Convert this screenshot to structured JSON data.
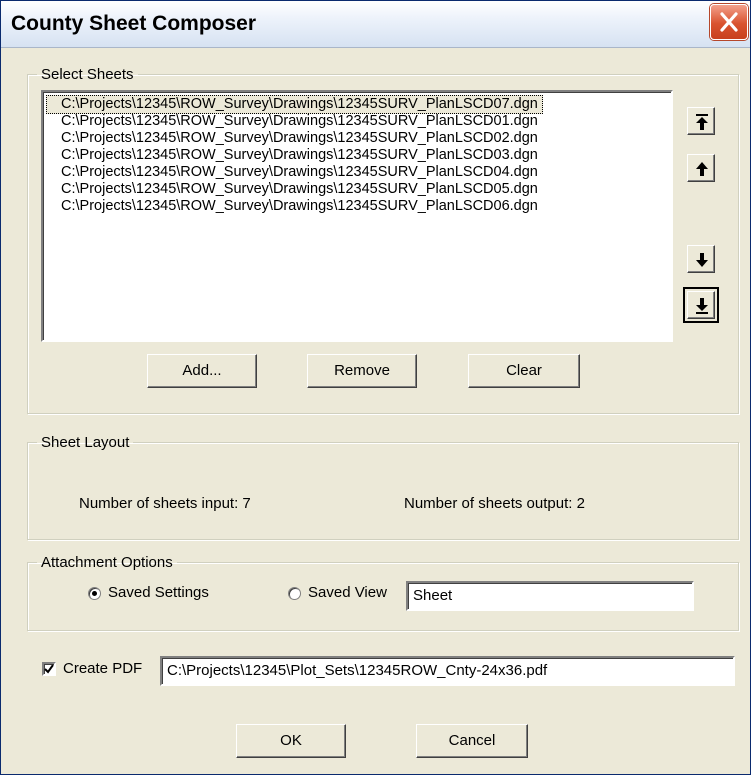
{
  "window": {
    "title": "County Sheet Composer"
  },
  "select_sheets": {
    "legend": "Select Sheets",
    "files": [
      "C:\\Projects\\12345\\ROW_Survey\\Drawings\\12345SURV_PlanLSCD07.dgn",
      "C:\\Projects\\12345\\ROW_Survey\\Drawings\\12345SURV_PlanLSCD01.dgn",
      "C:\\Projects\\12345\\ROW_Survey\\Drawings\\12345SURV_PlanLSCD02.dgn",
      "C:\\Projects\\12345\\ROW_Survey\\Drawings\\12345SURV_PlanLSCD03.dgn",
      "C:\\Projects\\12345\\ROW_Survey\\Drawings\\12345SURV_PlanLSCD04.dgn",
      "C:\\Projects\\12345\\ROW_Survey\\Drawings\\12345SURV_PlanLSCD05.dgn",
      "C:\\Projects\\12345\\ROW_Survey\\Drawings\\12345SURV_PlanLSCD06.dgn"
    ],
    "selected_index": 0,
    "buttons": {
      "add": "Add...",
      "remove": "Remove",
      "clear": "Clear"
    },
    "order_icons": [
      "move-to-top-icon",
      "move-up-icon",
      "move-down-icon",
      "move-to-bottom-icon"
    ]
  },
  "sheet_layout": {
    "legend": "Sheet Layout",
    "input_text": "Number of sheets input: 7",
    "output_text": "Number of sheets output: 2"
  },
  "attachment_options": {
    "legend": "Attachment Options",
    "saved_settings_label": "Saved Settings",
    "saved_view_label": "Saved View",
    "saved_view_value": "Sheet",
    "selected_option": "Saved Settings"
  },
  "pdf": {
    "label": "Create PDF",
    "checked": true,
    "path": "C:\\Projects\\12345\\Plot_Sets\\12345ROW_Cnty-24x36.pdf"
  },
  "footer": {
    "ok": "OK",
    "cancel": "Cancel"
  },
  "colors": {
    "dialog_bg": "#ece9d8",
    "close_button": "#d9532f",
    "title_gradient_end": "#d6e2f2"
  }
}
